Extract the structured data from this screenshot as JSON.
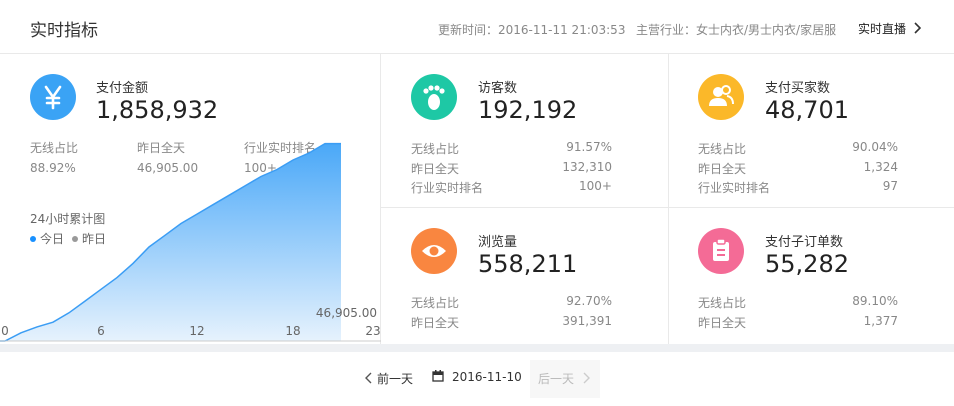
{
  "header": {
    "title": "实时指标",
    "updated": "更新时间：2016-11-11 21:03:53",
    "industry": "主营行业：女士内衣/男士内衣/家居服",
    "live_label": "实时直播"
  },
  "payment": {
    "label": "支付金额",
    "value": "1,858,932",
    "icon": "yen-icon",
    "color": "#3aa3f5",
    "stats": [
      {
        "label": "无线占比",
        "value": "88.92%"
      },
      {
        "label": "昨日全天",
        "value": "46,905.00"
      },
      {
        "label": "行业实时排名",
        "value": "100+"
      }
    ]
  },
  "chart": {
    "title": "24小时累计图",
    "legend": [
      "今日",
      "昨日"
    ],
    "legend_colors": [
      "#1890ff",
      "#999999"
    ],
    "yesterday_label": "46,905.00"
  },
  "chart_data": {
    "type": "area",
    "title": "24小时累计图",
    "x_ticks": [
      0,
      6,
      12,
      18,
      23
    ],
    "xlim": [
      0,
      23
    ],
    "series": [
      {
        "name": "今日",
        "x": [
          0,
          1,
          2,
          3,
          4,
          5,
          6,
          7,
          8,
          9,
          10,
          11,
          12,
          13,
          14,
          15,
          16,
          17,
          18,
          19,
          20,
          21
        ],
        "values": [
          0.0,
          0.035,
          0.06,
          0.08,
          0.12,
          0.17,
          0.22,
          0.27,
          0.33,
          0.4,
          0.45,
          0.5,
          0.54,
          0.58,
          0.62,
          0.66,
          0.7,
          0.73,
          0.77,
          0.8,
          0.84,
          0.84
        ]
      }
    ]
  },
  "visitors": {
    "label": "访客数",
    "value": "192,192",
    "icon": "footprint-icon",
    "color": "#1ec8a5",
    "stats": [
      {
        "label": "无线占比",
        "value": "91.57%"
      },
      {
        "label": "昨日全天",
        "value": "132,310"
      },
      {
        "label": "行业实时排名",
        "value": "100+"
      }
    ]
  },
  "buyers": {
    "label": "支付买家数",
    "value": "48,701",
    "icon": "users-icon",
    "color": "#fbb829",
    "stats": [
      {
        "label": "无线占比",
        "value": "90.04%"
      },
      {
        "label": "昨日全天",
        "value": "1,324"
      },
      {
        "label": "行业实时排名",
        "value": "97"
      }
    ]
  },
  "pageviews": {
    "label": "浏览量",
    "value": "558,211",
    "icon": "eye-icon",
    "color": "#f98640",
    "stats": [
      {
        "label": "无线占比",
        "value": "92.70%"
      },
      {
        "label": "昨日全天",
        "value": "391,391"
      }
    ]
  },
  "orders": {
    "label": "支付子订单数",
    "value": "55,282",
    "icon": "clipboard-icon",
    "color": "#f46b96",
    "stats": [
      {
        "label": "无线占比",
        "value": "89.10%"
      },
      {
        "label": "昨日全天",
        "value": "1,377"
      }
    ]
  },
  "footer": {
    "prev_label": "前一天",
    "date": "2016-11-10",
    "next_label": "后一天"
  }
}
